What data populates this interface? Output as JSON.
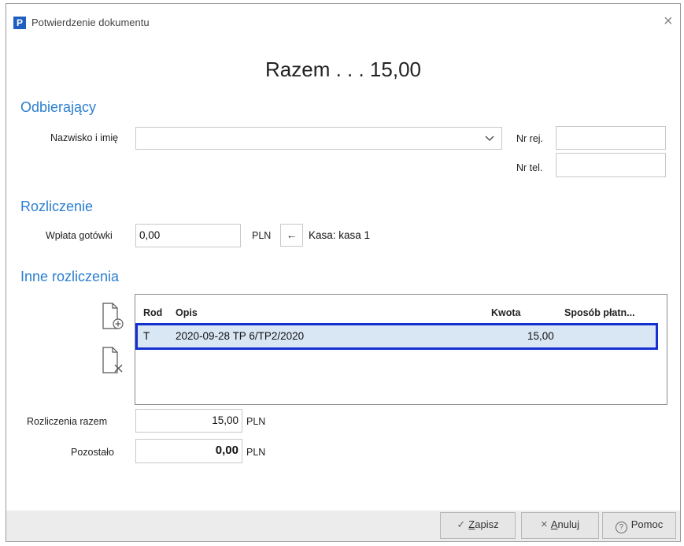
{
  "window": {
    "title": "Potwierdzenie dokumentu",
    "app_icon_letter": "P",
    "close_glyph": "×"
  },
  "summary": {
    "total_label": "Razem . . . 15,00"
  },
  "receiver": {
    "section_title": "Odbierający",
    "name_label": "Nazwisko i imię",
    "name_value": "",
    "reg_label": "Nr rej.",
    "reg_value": "",
    "tel_label": "Nr tel.",
    "tel_value": ""
  },
  "settlement": {
    "section_title": "Rozliczenie",
    "cash_label": "Wpłata gotówki",
    "cash_value": "0,00",
    "currency": "PLN",
    "arrow_glyph": "←",
    "cashbox_label": "Kasa: kasa 1"
  },
  "other": {
    "section_title": "Inne rozliczenia",
    "columns": [
      "Rod",
      "Opis",
      "Kwota",
      "Sposób płatn..."
    ],
    "rows": [
      {
        "rod": "T",
        "opis": "2020-09-28 TP 6/TP2/2020",
        "kwota": "15,00",
        "sposob": ""
      }
    ],
    "total_label": "Rozliczenia razem",
    "total_value": "15,00",
    "total_currency": "PLN",
    "remaining_label": "Pozostało",
    "remaining_value": "0,00",
    "remaining_currency": "PLN"
  },
  "buttons": {
    "save": {
      "icon": "✓",
      "label_underlined": "Z",
      "label_rest": "apisz"
    },
    "cancel": {
      "icon": "×",
      "label_underlined": "A",
      "label_rest": "nuluj"
    },
    "help": {
      "icon": "?",
      "label": "Pomoc"
    }
  },
  "colors": {
    "accent": "#2b7fd0",
    "selection_border": "#1530d0",
    "selection_fill": "#d9e6f3"
  }
}
